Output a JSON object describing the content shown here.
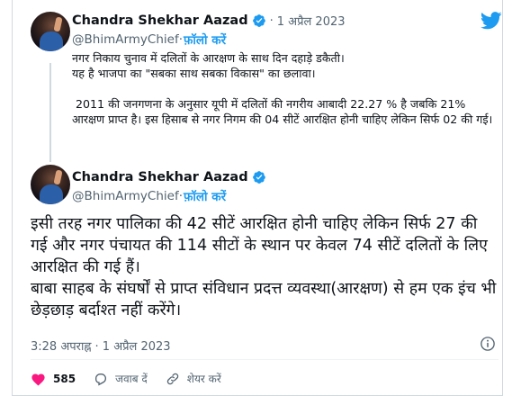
{
  "colors": {
    "accent": "#1d9bf0",
    "like": "#f91880",
    "muted": "#536471"
  },
  "brand": {
    "logo_icon": "twitter-bird-icon"
  },
  "tweet1": {
    "author_name": "Chandra Shekhar Aazad",
    "separator": "·",
    "date": "1 अप्रैल 2023",
    "handle": "@BhimArmyChief",
    "follow_sep": " · ",
    "follow_label": "फ़ॉलो करें",
    "text": "नगर निकाय चुनाव में दलितों के आरक्षण के साथ दिन दहाड़े डकैती।\nयह है भाजपा का \"सबका साथ सबका विकास\" का छलावा।\n\n 2011 की जनगणना के अनुसार यूपी में दलितों की नगरीय आबादी 22.27 % है जबकि 21% आरक्षण प्राप्त है। इस हिसाब से नगर निगम की 04 सीटें आरक्षित होनी चाहिए लेकिन सिर्फ 02 की गई।"
  },
  "tweet2": {
    "author_name": "Chandra Shekhar Aazad",
    "handle": "@BhimArmyChief",
    "follow_sep": " · ",
    "follow_label": "फ़ॉलो करें",
    "text": "इसी तरह नगर पालिका की 42 सीटें आरक्षित होनी चाहिए लेकिन सिर्फ 27 की गई और नगर पंचायत की 114 सीटों के स्थान पर केवल 74 सीटें दलितों के लिए आरक्षित की गई हैं।\nबाबा साहब के संघर्षों से प्राप्त संविधान प्रदत्त व्यवस्था(आरक्षण) से हम एक इंच भी छेड़छाड़ बर्दाश्त नहीं करेंगे।",
    "timestamp": "3:28 अपराह्न · 1 अप्रैल 2023"
  },
  "actions": {
    "like_count": "585",
    "reply_label": "जवाब दें",
    "share_label": "शेयर करें"
  }
}
